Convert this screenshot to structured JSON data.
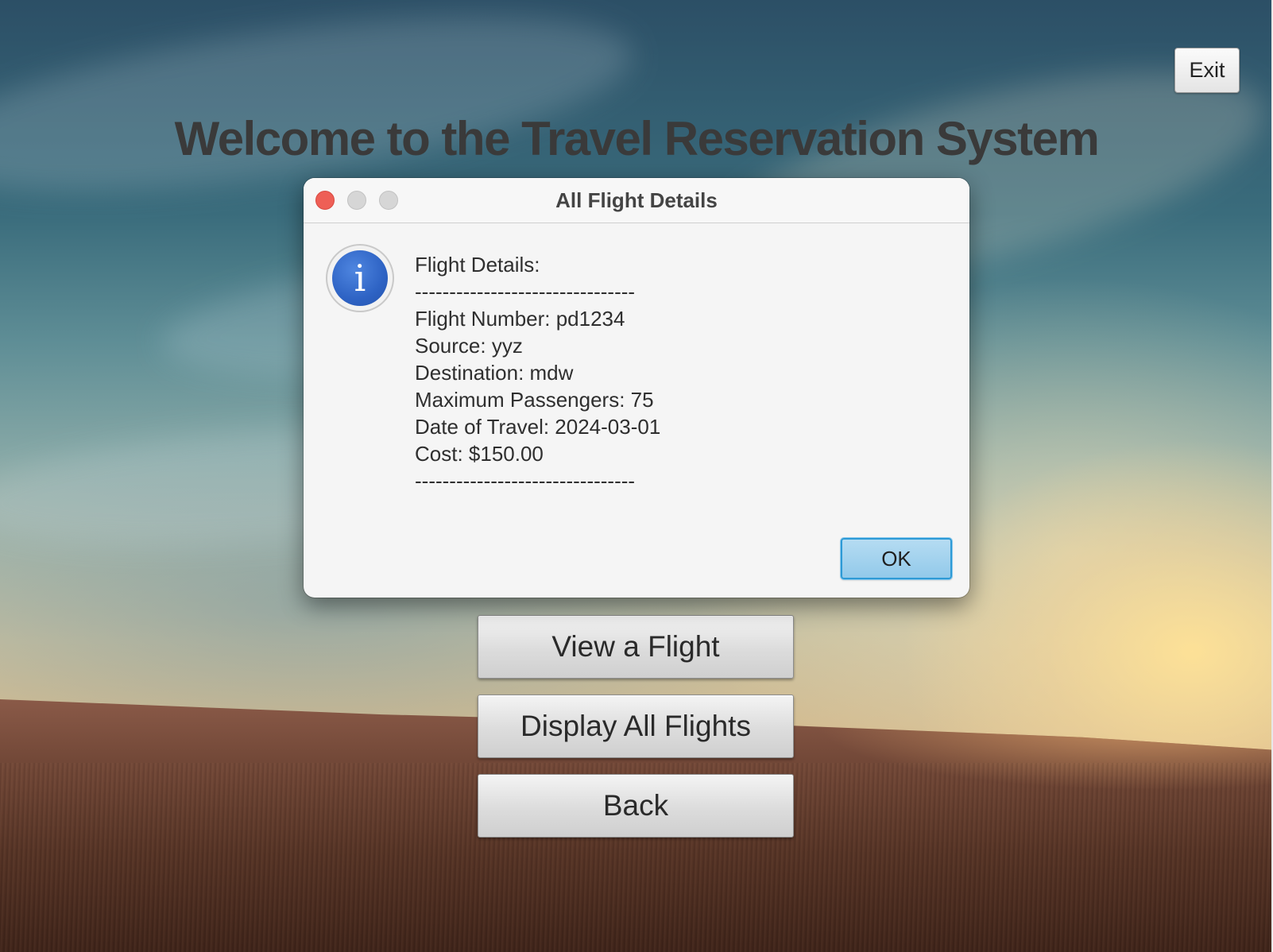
{
  "window": {
    "exit_label": "Exit",
    "welcome_title": "Welcome to the Travel Reservation System"
  },
  "menu": {
    "view_label": "View a Flight",
    "display_all_label": "Display All Flights",
    "back_label": "Back"
  },
  "dialog": {
    "title": "All Flight Details",
    "icon": "info-icon",
    "icon_glyph": "i",
    "lines": [
      "Flight Details:",
      "--------------------------------",
      "Flight Number: pd1234",
      "Source: yyz",
      "Destination: mdw",
      "Maximum Passengers: 75",
      "Date of Travel: 2024-03-01",
      "Cost: $150.00",
      "--------------------------------"
    ],
    "ok_label": "OK"
  },
  "colors": {
    "close_button": "#ee5f56",
    "info_icon": "#2e63c4",
    "ok_button_border": "#2d9ad6",
    "ok_button_fill": "#a3d2ee"
  }
}
